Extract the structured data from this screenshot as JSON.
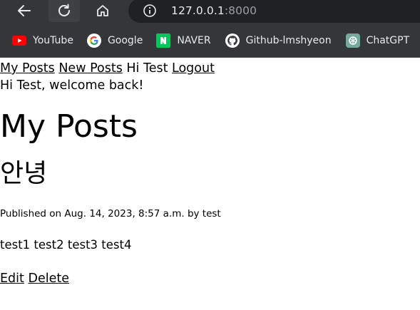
{
  "browser": {
    "url_host": "127.0.0.1",
    "url_port": ":8000",
    "bookmarks": [
      {
        "label": "YouTube",
        "icon": "youtube-icon"
      },
      {
        "label": "Google",
        "icon": "google-icon"
      },
      {
        "label": "NAVER",
        "icon": "naver-icon"
      },
      {
        "label": "Github-lmshyeon",
        "icon": "github-icon"
      },
      {
        "label": "ChatGPT",
        "icon": "chatgpt-icon"
      }
    ]
  },
  "nav": {
    "my_posts": "My Posts",
    "new_posts": "New Posts",
    "greeting": "Hi Test",
    "logout": "Logout"
  },
  "welcome": "Hi Test, welcome back!",
  "heading": "My Posts",
  "post": {
    "title": "안녕",
    "meta": "Published on Aug. 14, 2023, 8:57 a.m. by test",
    "content": "test1 test2 test3 test4",
    "edit": "Edit",
    "delete": "Delete"
  },
  "colors": {
    "chrome_bg": "#35363a",
    "omnibox_bg": "#202124",
    "youtube_red": "#ff0000",
    "naver_green": "#03c75a",
    "chatgpt_teal": "#74aa9c"
  }
}
